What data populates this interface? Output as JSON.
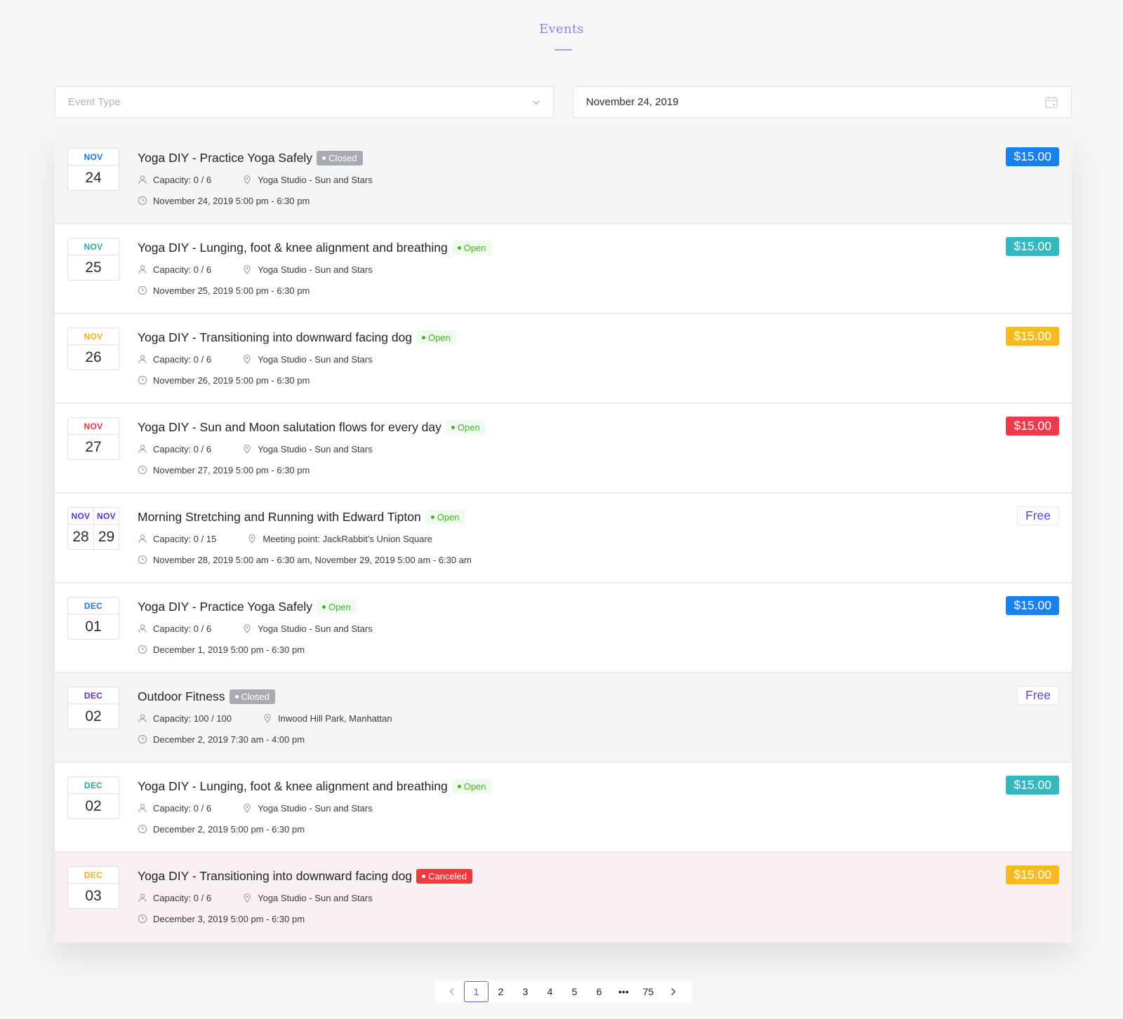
{
  "page": {
    "title": "Events"
  },
  "filters": {
    "event_type_placeholder": "Event Type",
    "date_value": "November 24, 2019"
  },
  "events": [
    {
      "months": [
        "NOV"
      ],
      "days": [
        "24"
      ],
      "month_color": "#1a78e6",
      "title": "Yoga DIY - Practice Yoga Safely",
      "status": "Closed",
      "status_kind": "closed",
      "capacity": "Capacity: 0 / 6",
      "location": "Yoga Studio - Sun and Stars",
      "time": "November 24, 2019 5:00 pm - 6:30 pm",
      "price": "$15.00",
      "price_color": "#1a80ee",
      "card_kind": "closed"
    },
    {
      "months": [
        "NOV"
      ],
      "days": [
        "25"
      ],
      "month_color": "#2aa7a8",
      "title": "Yoga DIY - Lunging, foot & knee alignment and breathing",
      "status": "Open",
      "status_kind": "open",
      "capacity": "Capacity: 0 / 6",
      "location": "Yoga Studio - Sun and Stars",
      "time": "November 25, 2019 5:00 pm - 6:30 pm",
      "price": "$15.00",
      "price_color": "#37b7bd",
      "card_kind": "normal"
    },
    {
      "months": [
        "NOV"
      ],
      "days": [
        "26"
      ],
      "month_color": "#f0b21c",
      "title": "Yoga DIY - Transitioning into downward facing dog",
      "status": "Open",
      "status_kind": "open",
      "capacity": "Capacity: 0 / 6",
      "location": "Yoga Studio - Sun and Stars",
      "time": "November 26, 2019 5:00 pm - 6:30 pm",
      "price": "$15.00",
      "price_color": "#f7bb21",
      "card_kind": "normal"
    },
    {
      "months": [
        "NOV"
      ],
      "days": [
        "27"
      ],
      "month_color": "#e83843",
      "title": "Yoga DIY - Sun and Moon salutation flows for every day",
      "status": "Open",
      "status_kind": "open",
      "capacity": "Capacity: 0 / 6",
      "location": "Yoga Studio - Sun and Stars",
      "time": "November 27, 2019 5:00 pm - 6:30 pm",
      "price": "$15.00",
      "price_color": "#ef3a4b",
      "card_kind": "normal"
    },
    {
      "months": [
        "NOV",
        "NOV"
      ],
      "days": [
        "28",
        "29"
      ],
      "month_color": "#5b2fd1",
      "title": "Morning Stretching and Running with Edward Tipton",
      "status": "Open",
      "status_kind": "open",
      "capacity": "Capacity: 0 / 15",
      "location": "Meeting point: JackRabbit's Union Square",
      "time": "November 28, 2019 5:00 am - 6:30 am, November 29, 2019 5:00 am - 6:30 am",
      "price": "Free",
      "price_color": "free",
      "card_kind": "normal"
    },
    {
      "months": [
        "DEC"
      ],
      "days": [
        "01"
      ],
      "month_color": "#1a78e6",
      "title": "Yoga DIY - Practice Yoga Safely",
      "status": "Open",
      "status_kind": "open",
      "capacity": "Capacity: 0 / 6",
      "location": "Yoga Studio - Sun and Stars",
      "time": "December 1, 2019 5:00 pm - 6:30 pm",
      "price": "$15.00",
      "price_color": "#1a80ee",
      "card_kind": "normal"
    },
    {
      "months": [
        "DEC"
      ],
      "days": [
        "02"
      ],
      "month_color": "#5b2fd1",
      "title": "Outdoor Fitness",
      "status": "Closed",
      "status_kind": "closed",
      "capacity": "Capacity: 100 / 100",
      "location": "Inwood Hill Park, Manhattan",
      "time": "December 2, 2019 7:30 am - 4:00 pm",
      "price": "Free",
      "price_color": "free",
      "card_kind": "closed"
    },
    {
      "months": [
        "DEC"
      ],
      "days": [
        "02"
      ],
      "month_color": "#2aa7a8",
      "title": "Yoga DIY - Lunging, foot & knee alignment and breathing",
      "status": "Open",
      "status_kind": "open",
      "capacity": "Capacity: 0 / 6",
      "location": "Yoga Studio - Sun and Stars",
      "time": "December 2, 2019 5:00 pm - 6:30 pm",
      "price": "$15.00",
      "price_color": "#37b7bd",
      "card_kind": "normal"
    },
    {
      "months": [
        "DEC"
      ],
      "days": [
        "03"
      ],
      "month_color": "#f0b21c",
      "title": "Yoga DIY - Transitioning into downward facing dog",
      "status": "Canceled",
      "status_kind": "canceled",
      "capacity": "Capacity: 0 / 6",
      "location": "Yoga Studio - Sun and Stars",
      "time": "December 3, 2019 5:00 pm - 6:30 pm",
      "price": "$15.00",
      "price_color": "#f7bb21",
      "card_kind": "canceled"
    }
  ],
  "pagination": {
    "prev_icon": "chevron-left-icon",
    "next_icon": "chevron-right-icon",
    "pages": [
      "1",
      "2",
      "3",
      "4",
      "5",
      "6",
      "•••",
      "75"
    ],
    "current": "1"
  }
}
